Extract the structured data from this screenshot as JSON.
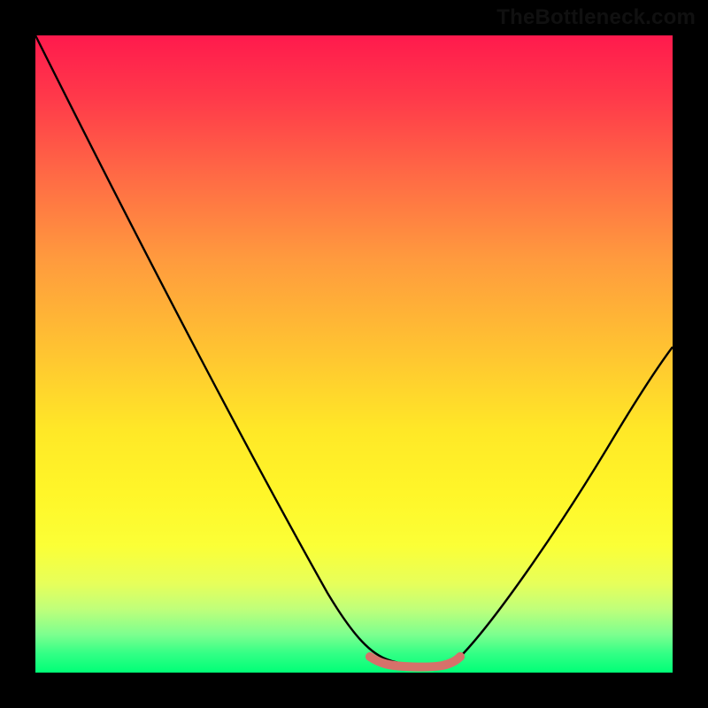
{
  "watermark": "TheBottleneck.com",
  "chart_data": {
    "type": "line",
    "title": "",
    "xlabel": "",
    "ylabel": "",
    "xlim": [
      0,
      100
    ],
    "ylim": [
      0,
      100
    ],
    "x": [
      0,
      5,
      10,
      15,
      20,
      25,
      30,
      35,
      40,
      45,
      50,
      52,
      55,
      58,
      60,
      62,
      65,
      70,
      75,
      80,
      85,
      90,
      95,
      100
    ],
    "values": [
      100,
      90,
      80,
      70,
      61,
      52,
      43,
      35,
      27,
      19,
      10,
      6,
      2,
      1,
      1,
      1,
      2,
      6,
      13,
      22,
      31,
      40,
      48,
      52
    ],
    "flat_region": {
      "x_start": 55,
      "x_end": 66,
      "value": 1
    },
    "gradient_stops": [
      {
        "pct": 0,
        "color": "#ff1a4d"
      },
      {
        "pct": 50,
        "color": "#ffc531"
      },
      {
        "pct": 80,
        "color": "#fbff36"
      },
      {
        "pct": 100,
        "color": "#00ff77"
      }
    ]
  }
}
